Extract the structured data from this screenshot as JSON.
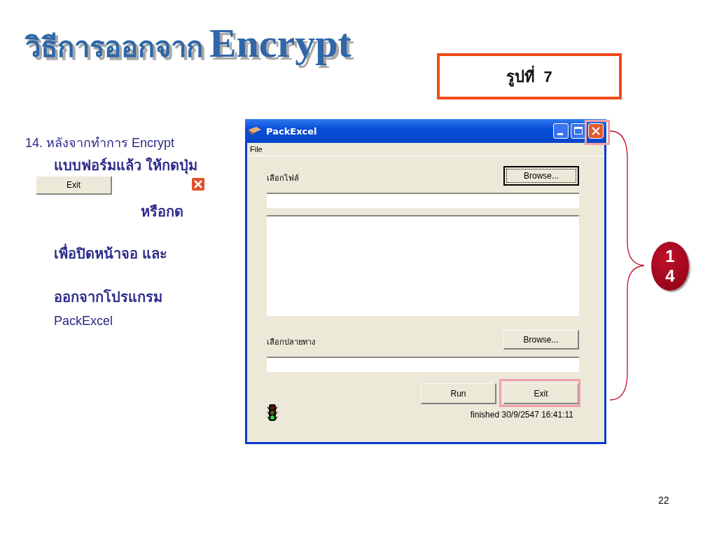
{
  "slide_title": {
    "thai": "วิธีการออกจาก",
    "latin": "Encrypt"
  },
  "figure_label": "รูปที่  7",
  "instructions": {
    "lines": [
      "14. หลังจากทำการ Encrypt",
      "แบบฟอร์มแล้ว ให้กดปุ่ม"
    ],
    "sample_button": "Exit",
    "after": [
      "หรือกด",
      "เพื่อปิดหน้าจอ และ",
      "ออกจากโปรแกรม",
      "PackExcel"
    ]
  },
  "window": {
    "title": "PackExcel",
    "close_highlighted": true,
    "menu": [
      "File"
    ],
    "source": {
      "label": "เลือกไฟล์",
      "button": {
        "label": "Browse...",
        "focused": true
      }
    },
    "destination": {
      "label": "เลือกปลายทาง",
      "button": {
        "label": "Browse...",
        "focused": false
      }
    },
    "buttons": [
      {
        "label": "Run",
        "highlighted": false
      },
      {
        "label": "Exit",
        "highlighted": true
      }
    ],
    "status": "finished 30/9/2547 16:41:11"
  },
  "step_badge": "14",
  "page_number": "22"
}
